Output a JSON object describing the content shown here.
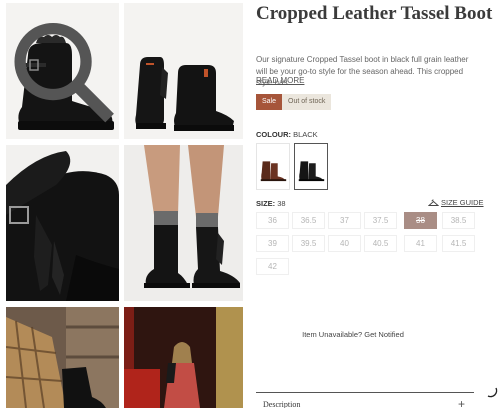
{
  "product": {
    "title": "Cropped Leather Tassel Boot",
    "description": "Our signature Cropped Tassel boot in black full grain leather will be your go-to style for the season ahead. This cropped style has ...",
    "read_more": "READ MORE",
    "badges": {
      "sale": "Sale",
      "stock": "Out of stock"
    }
  },
  "colour": {
    "label": "COLOUR:",
    "value": "BLACK"
  },
  "size": {
    "label": "SIZE:",
    "value": "38",
    "guide_label": "SIZE GUIDE",
    "options": [
      "36",
      "36.5",
      "37",
      "37.5",
      "38",
      "38.5",
      "39",
      "39.5",
      "40",
      "40.5",
      "41",
      "41.5",
      "42"
    ],
    "selected": "38"
  },
  "notify": {
    "text": "Item Unavailable? Get Notified"
  },
  "accordion": {
    "description_label": "Description",
    "toggle_symbol": "+"
  },
  "colors": {
    "sale_badge": "#a6553a",
    "stock_badge_bg": "#ebe6dd",
    "selected_size_bg": "#a98d85"
  },
  "icons": {
    "zoom": "magnifier-icon",
    "size_guide": "hanger-icon",
    "toggle": "plus-icon",
    "loading": "spinner-icon"
  }
}
